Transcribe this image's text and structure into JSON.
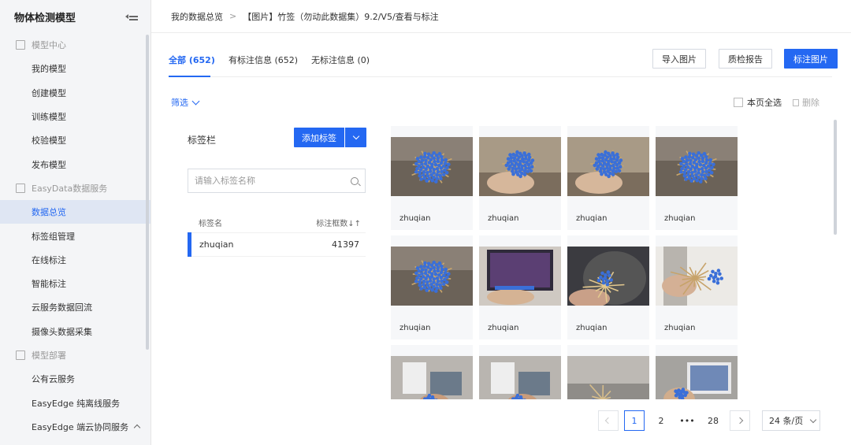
{
  "sidebar": {
    "title": "物体检测模型",
    "items": [
      {
        "type": "group",
        "label": "模型中心"
      },
      {
        "type": "item",
        "label": "我的模型"
      },
      {
        "type": "item",
        "label": "创建模型"
      },
      {
        "type": "item",
        "label": "训练模型"
      },
      {
        "type": "item",
        "label": "校验模型"
      },
      {
        "type": "item",
        "label": "发布模型"
      },
      {
        "type": "group",
        "label": "EasyData数据服务"
      },
      {
        "type": "item",
        "label": "数据总览",
        "active": true
      },
      {
        "type": "item",
        "label": "标签组管理"
      },
      {
        "type": "item",
        "label": "在线标注"
      },
      {
        "type": "item",
        "label": "智能标注"
      },
      {
        "type": "item",
        "label": "云服务数据回流"
      },
      {
        "type": "item",
        "label": "摄像头数据采集"
      },
      {
        "type": "group",
        "label": "模型部署"
      },
      {
        "type": "item",
        "label": "公有云服务"
      },
      {
        "type": "item",
        "label": "EasyEdge 纯离线服务"
      },
      {
        "type": "item",
        "label": "EasyEdge 端云协同服务",
        "chevron": true
      }
    ]
  },
  "breadcrumb": {
    "root": "我的数据总览",
    "separator": ">",
    "current": "【图片】竹签（勿动此数据集）9.2/V5/查看与标注"
  },
  "tabs": [
    {
      "label": "全部 (652)",
      "active": true
    },
    {
      "label": "有标注信息 (652)"
    },
    {
      "label": "无标注信息 (0)"
    }
  ],
  "actions": {
    "import": "导入图片",
    "report": "质检报告",
    "annotate": "标注图片"
  },
  "filter_label": "筛选",
  "select_all_label": "本页全选",
  "delete_label": "删除",
  "label_panel": {
    "title": "标签栏",
    "add_button": "添加标签",
    "search_placeholder": "请输入标签名称",
    "col_name": "标签名",
    "col_count": "标注框数↓↑",
    "rows": [
      {
        "name": "zhuqian",
        "count": "41397"
      }
    ]
  },
  "images": [
    {
      "caption": "zhuqian",
      "scene": "pile"
    },
    {
      "caption": "zhuqian",
      "scene": "hand-pile"
    },
    {
      "caption": "zhuqian",
      "scene": "hand-pile"
    },
    {
      "caption": "zhuqian",
      "scene": "pile"
    },
    {
      "caption": "zhuqian",
      "scene": "pile"
    },
    {
      "caption": "zhuqian",
      "scene": "laptop"
    },
    {
      "caption": "zhuqian",
      "scene": "sticks-dark"
    },
    {
      "caption": "zhuqian",
      "scene": "sticks-light"
    },
    {
      "caption": "",
      "scene": "office"
    },
    {
      "caption": "",
      "scene": "office"
    },
    {
      "caption": "",
      "scene": "sticks-gray"
    },
    {
      "caption": "",
      "scene": "monitor"
    }
  ],
  "pagination": {
    "pages": [
      "1",
      "2",
      "•••",
      "28"
    ],
    "current": "1",
    "page_size": "24 条/页"
  },
  "colors": {
    "accent": "#2468f2",
    "annotation": "#3a6fd8"
  }
}
